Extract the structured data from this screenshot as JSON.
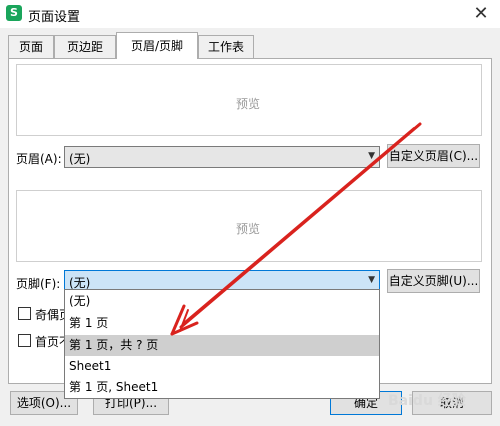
{
  "window": {
    "title": "页面设置",
    "icon_letter": "S",
    "close_glyph": "✕"
  },
  "tabs": [
    {
      "label": "页面"
    },
    {
      "label": "页边距"
    },
    {
      "label": "页眉/页脚",
      "active": true
    },
    {
      "label": "工作表"
    }
  ],
  "header": {
    "preview": "预览",
    "label": "页眉(A):",
    "value": "(无)",
    "custom_button": "自定义页眉(C)..."
  },
  "footer": {
    "preview": "预览",
    "label": "页脚(F):",
    "value": "(无)",
    "custom_button": "自定义页脚(U)..."
  },
  "dropdown": {
    "options": [
      "(无)",
      "第 1 页",
      "第 1 页，共 ? 页",
      "Sheet1",
      "第 1 页, Sheet1"
    ],
    "highlighted_index": 2
  },
  "checkboxes": [
    {
      "label": "奇偶页",
      "checked": false
    },
    {
      "label": "首页不",
      "checked": false
    }
  ],
  "buttons": {
    "options": "选项(O)...",
    "print": "打印(P)...",
    "ok": "确定",
    "cancel": "取消"
  },
  "annotation": {
    "color": "#d9231e"
  }
}
